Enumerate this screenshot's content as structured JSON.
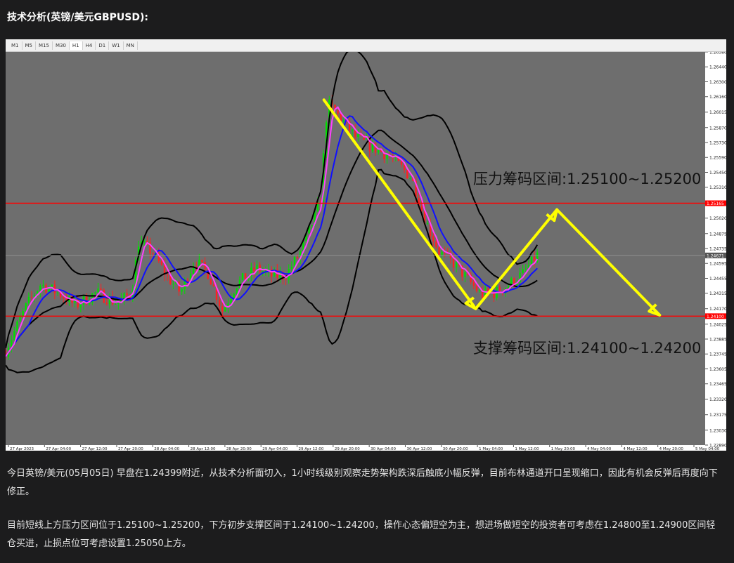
{
  "heading": "技术分析(英镑/美元GBPUSD):",
  "toolbar": {
    "timeframes": [
      "M1",
      "M5",
      "M15",
      "M30",
      "H1",
      "H4",
      "D1",
      "W1",
      "MN"
    ],
    "active": "H1"
  },
  "colors": {
    "plot_bg": "#6e6e6e",
    "bull": "#00e000",
    "bear": "#ff2020",
    "bollinger": "#000000",
    "ma_fast": "#ff40ff",
    "ma_slow": "#1010ff",
    "arrow": "#ffff00",
    "level_line": "#ff0000"
  },
  "chart_data": {
    "type": "candlestick",
    "symbol": "GBPUSD",
    "timeframe": "H1",
    "ylim": [
      1.2289,
      1.2658
    ],
    "y_ticks": [
      "1.26580",
      "1.26440",
      "1.26300",
      "1.26160",
      "1.26015",
      "1.25870",
      "1.25730",
      "1.25590",
      "1.25450",
      "1.25310",
      "1.25165",
      "1.25020",
      "1.24875",
      "1.24735",
      "1.24595",
      "1.24455",
      "1.24315",
      "1.24170",
      "1.24025",
      "1.23885",
      "1.23745",
      "1.23605",
      "1.23465",
      "1.23320",
      "1.23175",
      "1.23030",
      "1.22890"
    ],
    "x_ticks": [
      "27 Apr 2023",
      "27 Apr 04:00",
      "27 Apr 12:00",
      "27 Apr 20:00",
      "28 Apr 04:00",
      "28 Apr 12:00",
      "28 Apr 20:00",
      "29 Apr 04:00",
      "29 Apr 12:00",
      "29 Apr 20:00",
      "30 Apr 04:00",
      "30 Apr 12:00",
      "30 Apr 20:00",
      "1 May 04:00",
      "1 May 12:00",
      "1 May 20:00",
      "4 May 04:00",
      "4 May 12:00",
      "4 May 20:00",
      "5 May 04:00"
    ],
    "price_labels": {
      "upper_level": "1.25165",
      "current": "1.24671",
      "lower_level": "1.24100"
    },
    "levels": [
      1.2516,
      1.241
    ],
    "current_price": 1.2467,
    "annotations": {
      "resistance": "压力筹码区间:1.25100~1.25200",
      "support": "支撑筹码区间:1.24100~1.24200"
    },
    "arrow_path": [
      {
        "t": 0.455,
        "p": 1.2613
      },
      {
        "t": 0.672,
        "p": 1.2417
      },
      {
        "t": 0.788,
        "p": 1.251
      },
      {
        "t": 0.935,
        "p": 1.2411
      }
    ],
    "price_path": [
      [
        0.0,
        1.2378
      ],
      [
        0.03,
        1.242
      ],
      [
        0.05,
        1.244
      ],
      [
        0.08,
        1.243
      ],
      [
        0.1,
        1.242
      ],
      [
        0.13,
        1.2432
      ],
      [
        0.16,
        1.2422
      ],
      [
        0.18,
        1.2432
      ],
      [
        0.19,
        1.248
      ],
      [
        0.21,
        1.247
      ],
      [
        0.23,
        1.2448
      ],
      [
        0.25,
        1.2432
      ],
      [
        0.27,
        1.2462
      ],
      [
        0.29,
        1.245
      ],
      [
        0.31,
        1.2415
      ],
      [
        0.33,
        1.244
      ],
      [
        0.36,
        1.2455
      ],
      [
        0.38,
        1.2448
      ],
      [
        0.4,
        1.2448
      ],
      [
        0.42,
        1.2468
      ],
      [
        0.44,
        1.25
      ],
      [
        0.45,
        1.252
      ],
      [
        0.46,
        1.261
      ],
      [
        0.48,
        1.2595
      ],
      [
        0.5,
        1.2578
      ],
      [
        0.52,
        1.257
      ],
      [
        0.55,
        1.256
      ],
      [
        0.58,
        1.254
      ],
      [
        0.6,
        1.25
      ],
      [
        0.62,
        1.247
      ],
      [
        0.64,
        1.246
      ],
      [
        0.66,
        1.2445
      ],
      [
        0.68,
        1.243
      ],
      [
        0.7,
        1.2432
      ],
      [
        0.72,
        1.244
      ],
      [
        0.74,
        1.245
      ],
      [
        0.76,
        1.2467
      ]
    ]
  },
  "paragraphs": [
    "今日英镑/美元(05月05日) 早盘在1.24399附近，从技术分析面切入，1小时线级别观察走势架构跌深后触底小幅反弹，目前布林通道开口呈现缩口，因此有机会反弹后再度向下修正。",
    "目前短线上方压力区间位于1.25100~1.25200，下方初步支撑区间于1.24100~1.24200，操作心态偏短空为主，想进场做短空的投资者可考虑在1.24800至1.24900区间轻仓买进，止损点位可考虑设置1.25050上方。"
  ]
}
